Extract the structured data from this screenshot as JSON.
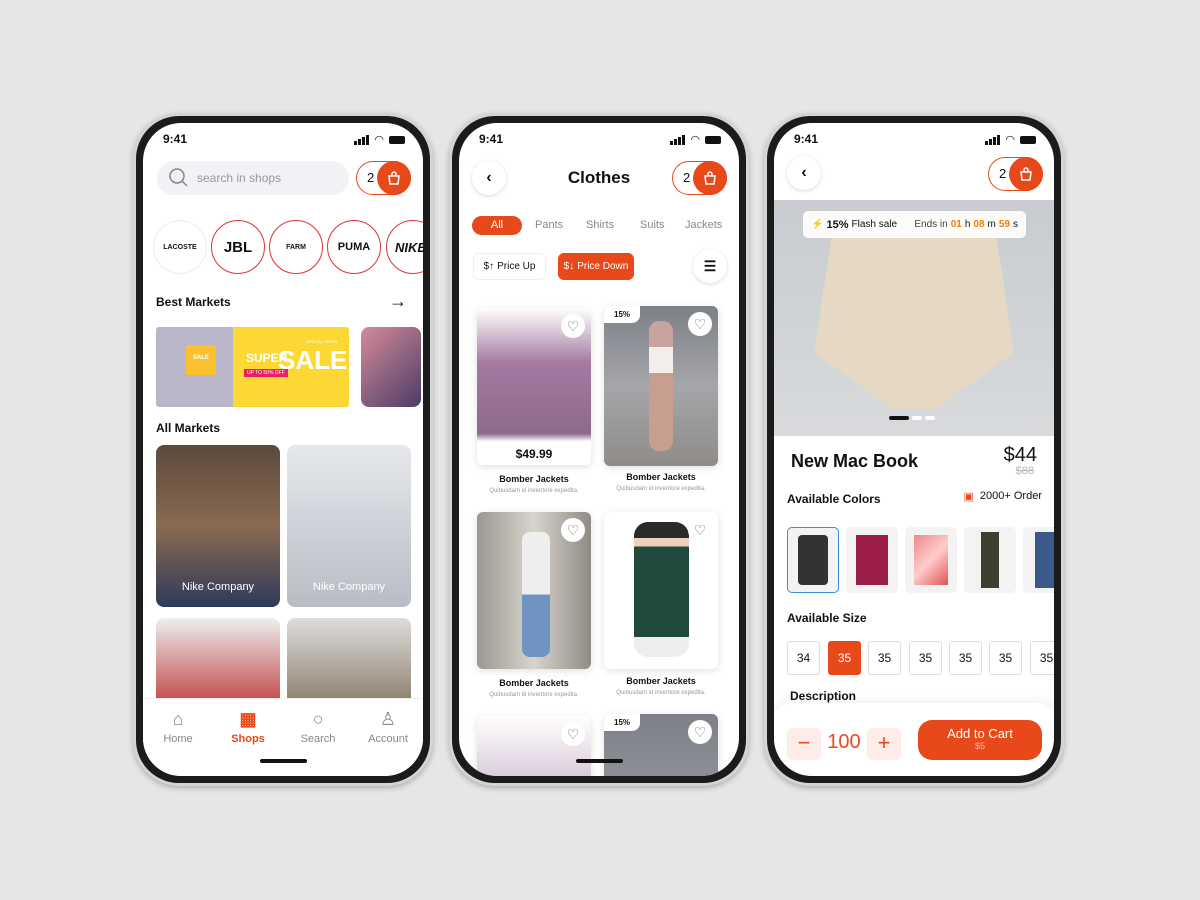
{
  "accent": "#e8491a",
  "status_time": "9:41",
  "cart_count": "2",
  "shops": {
    "search_placeholder": "search in shops",
    "brands": [
      "LACOSTE",
      "JBL",
      "FARM",
      "PUMA",
      "NIKE"
    ],
    "best_markets": "Best Markets",
    "banner": {
      "special": "SPECIAL OFFER",
      "super": "SUPER",
      "sale": "SALE",
      "up_to": "UP TO 50% OFF",
      "tag": "SALE"
    },
    "all_markets": "All Markets",
    "markets": [
      "Nike Company",
      "Nike Company",
      "",
      ""
    ],
    "nav": [
      {
        "label": "Home",
        "icon": "home-icon"
      },
      {
        "label": "Shops",
        "icon": "shop-icon"
      },
      {
        "label": "Search",
        "icon": "search-icon"
      },
      {
        "label": "Account",
        "icon": "account-icon"
      }
    ],
    "active_nav": "Shops"
  },
  "clothes": {
    "title": "Clothes",
    "tabs": [
      "All",
      "Pants",
      "Shirts",
      "Suits",
      "Jackets"
    ],
    "active_tab": "All",
    "sort": {
      "up": "Price Up",
      "down": "Price Down",
      "symbol_up": "$↑",
      "symbol_down": "$↓"
    },
    "products": [
      {
        "title": "Bomber Jackets",
        "desc": "Quibusdam id inventore expedita.",
        "price": "$49.99",
        "badge": ""
      },
      {
        "title": "Bomber Jackets",
        "desc": "Quibusdam id inventore expedita.",
        "price": "",
        "badge": "15%"
      },
      {
        "title": "Bomber Jackets",
        "desc": "Quibusdam id inventore expedita.",
        "price": "",
        "badge": ""
      },
      {
        "title": "Bomber Jackets",
        "desc": "Quibusdam id inventore expedita.",
        "price": "",
        "badge": ""
      },
      {
        "title": "",
        "desc": "",
        "price": "",
        "badge": ""
      },
      {
        "title": "",
        "desc": "",
        "price": "",
        "badge": "15%"
      }
    ]
  },
  "detail": {
    "flash": {
      "pct": "15%",
      "label": "Flash sale",
      "ends": "Ends in",
      "h": "01",
      "h_unit": "h",
      "m": "08",
      "m_unit": "m",
      "s": "59",
      "s_unit": "s"
    },
    "carousel_active": 1,
    "carousel_count": 3,
    "title": "New Mac Book",
    "price": "$44",
    "old_price": "$88",
    "colors_label": "Available Colors",
    "orders": "2000+ Order",
    "size_label": "Available Size",
    "sizes": [
      "34",
      "35",
      "35",
      "35",
      "35",
      "35",
      "35"
    ],
    "selected_size_index": 1,
    "description_label": "Description",
    "quantity": "100",
    "minus": "−",
    "plus": "+",
    "add_to_cart": "Add to Cart",
    "add_price": "$5"
  }
}
